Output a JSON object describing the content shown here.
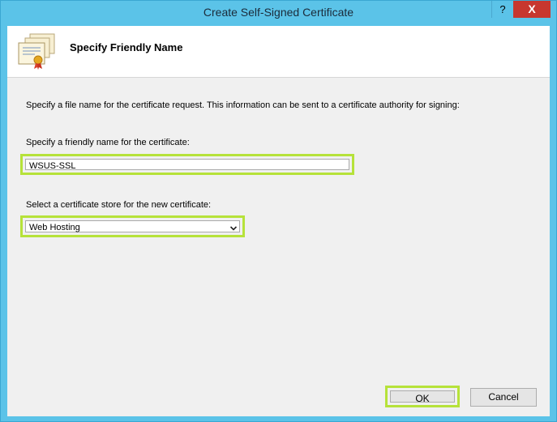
{
  "window": {
    "title": "Create Self-Signed Certificate",
    "help_label": "?",
    "close_label": "X"
  },
  "header": {
    "title": "Specify Friendly Name"
  },
  "content": {
    "description": "Specify a file name for the certificate request.  This information can be sent to a certificate authority for signing:",
    "friendly_name_label": "Specify a friendly name for the certificate:",
    "friendly_name_value": "WSUS-SSL",
    "store_label": "Select a certificate store for the new certificate:",
    "store_value": "Web Hosting"
  },
  "buttons": {
    "ok_label": "OK",
    "cancel_label": "Cancel"
  },
  "colors": {
    "window_frame": "#5bc3e8",
    "highlight": "#b6e23a",
    "close_button": "#c7372f"
  },
  "icons": {
    "header": "certificate-icon",
    "dropdown": "chevron-down-icon"
  }
}
